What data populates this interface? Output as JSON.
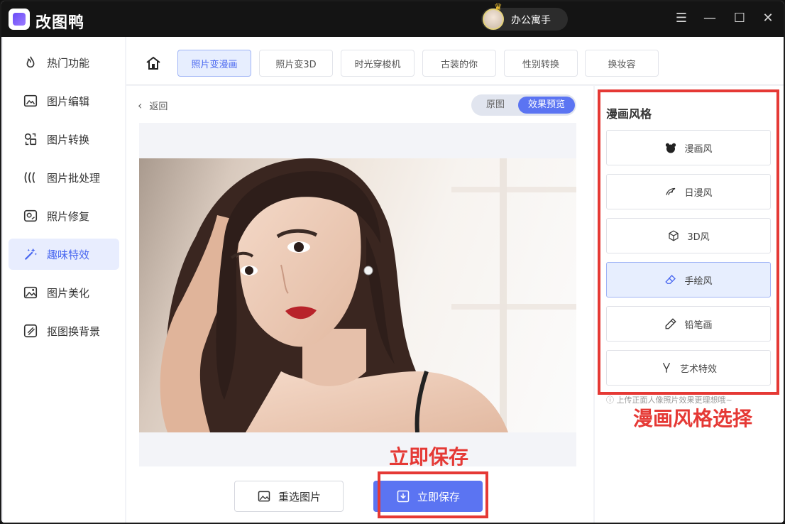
{
  "app": {
    "title": "改图鸭",
    "user_name": "办公寓手"
  },
  "window_controls": {
    "menu": "☰",
    "minimize": "—",
    "maximize": "☐",
    "close": "✕"
  },
  "sidebar": {
    "items": [
      {
        "label": "热门功能",
        "icon": "flame-icon"
      },
      {
        "label": "图片编辑",
        "icon": "image-edit-icon"
      },
      {
        "label": "图片转换",
        "icon": "convert-icon"
      },
      {
        "label": "图片批处理",
        "icon": "batch-icon"
      },
      {
        "label": "照片修复",
        "icon": "repair-icon"
      },
      {
        "label": "趣味特效",
        "icon": "magic-wand-icon",
        "active": true
      },
      {
        "label": "图片美化",
        "icon": "beautify-icon"
      },
      {
        "label": "抠图换背景",
        "icon": "cutout-icon"
      }
    ]
  },
  "tabs": [
    {
      "label": "照片变漫画",
      "active": true
    },
    {
      "label": "照片变3D"
    },
    {
      "label": "时光穿梭机"
    },
    {
      "label": "古装的你"
    },
    {
      "label": "性别转换"
    },
    {
      "label": "换妆容"
    }
  ],
  "main": {
    "back_label": "返回",
    "toggle": {
      "original": "原图",
      "preview": "效果预览"
    },
    "reselect_label": "重选图片",
    "save_label": "立即保存"
  },
  "panel": {
    "title": "漫画风格",
    "styles": [
      {
        "label": "漫画风",
        "icon": "bear-icon"
      },
      {
        "label": "日漫风",
        "icon": "anime-icon"
      },
      {
        "label": "3D风",
        "icon": "cube-icon"
      },
      {
        "label": "手绘风",
        "icon": "eraser-icon",
        "active": true
      },
      {
        "label": "铅笔画",
        "icon": "pencil-icon"
      },
      {
        "label": "艺术特效",
        "icon": "art-brush-icon"
      }
    ],
    "hint": "ⓘ 上传正面人像照片效果更理想哦~"
  },
  "annotations": {
    "save": "立即保存",
    "style_select": "漫画风格选择"
  },
  "colors": {
    "accent": "#5b74f2",
    "annotation_red": "#e53935",
    "title_bar": "#141414"
  }
}
